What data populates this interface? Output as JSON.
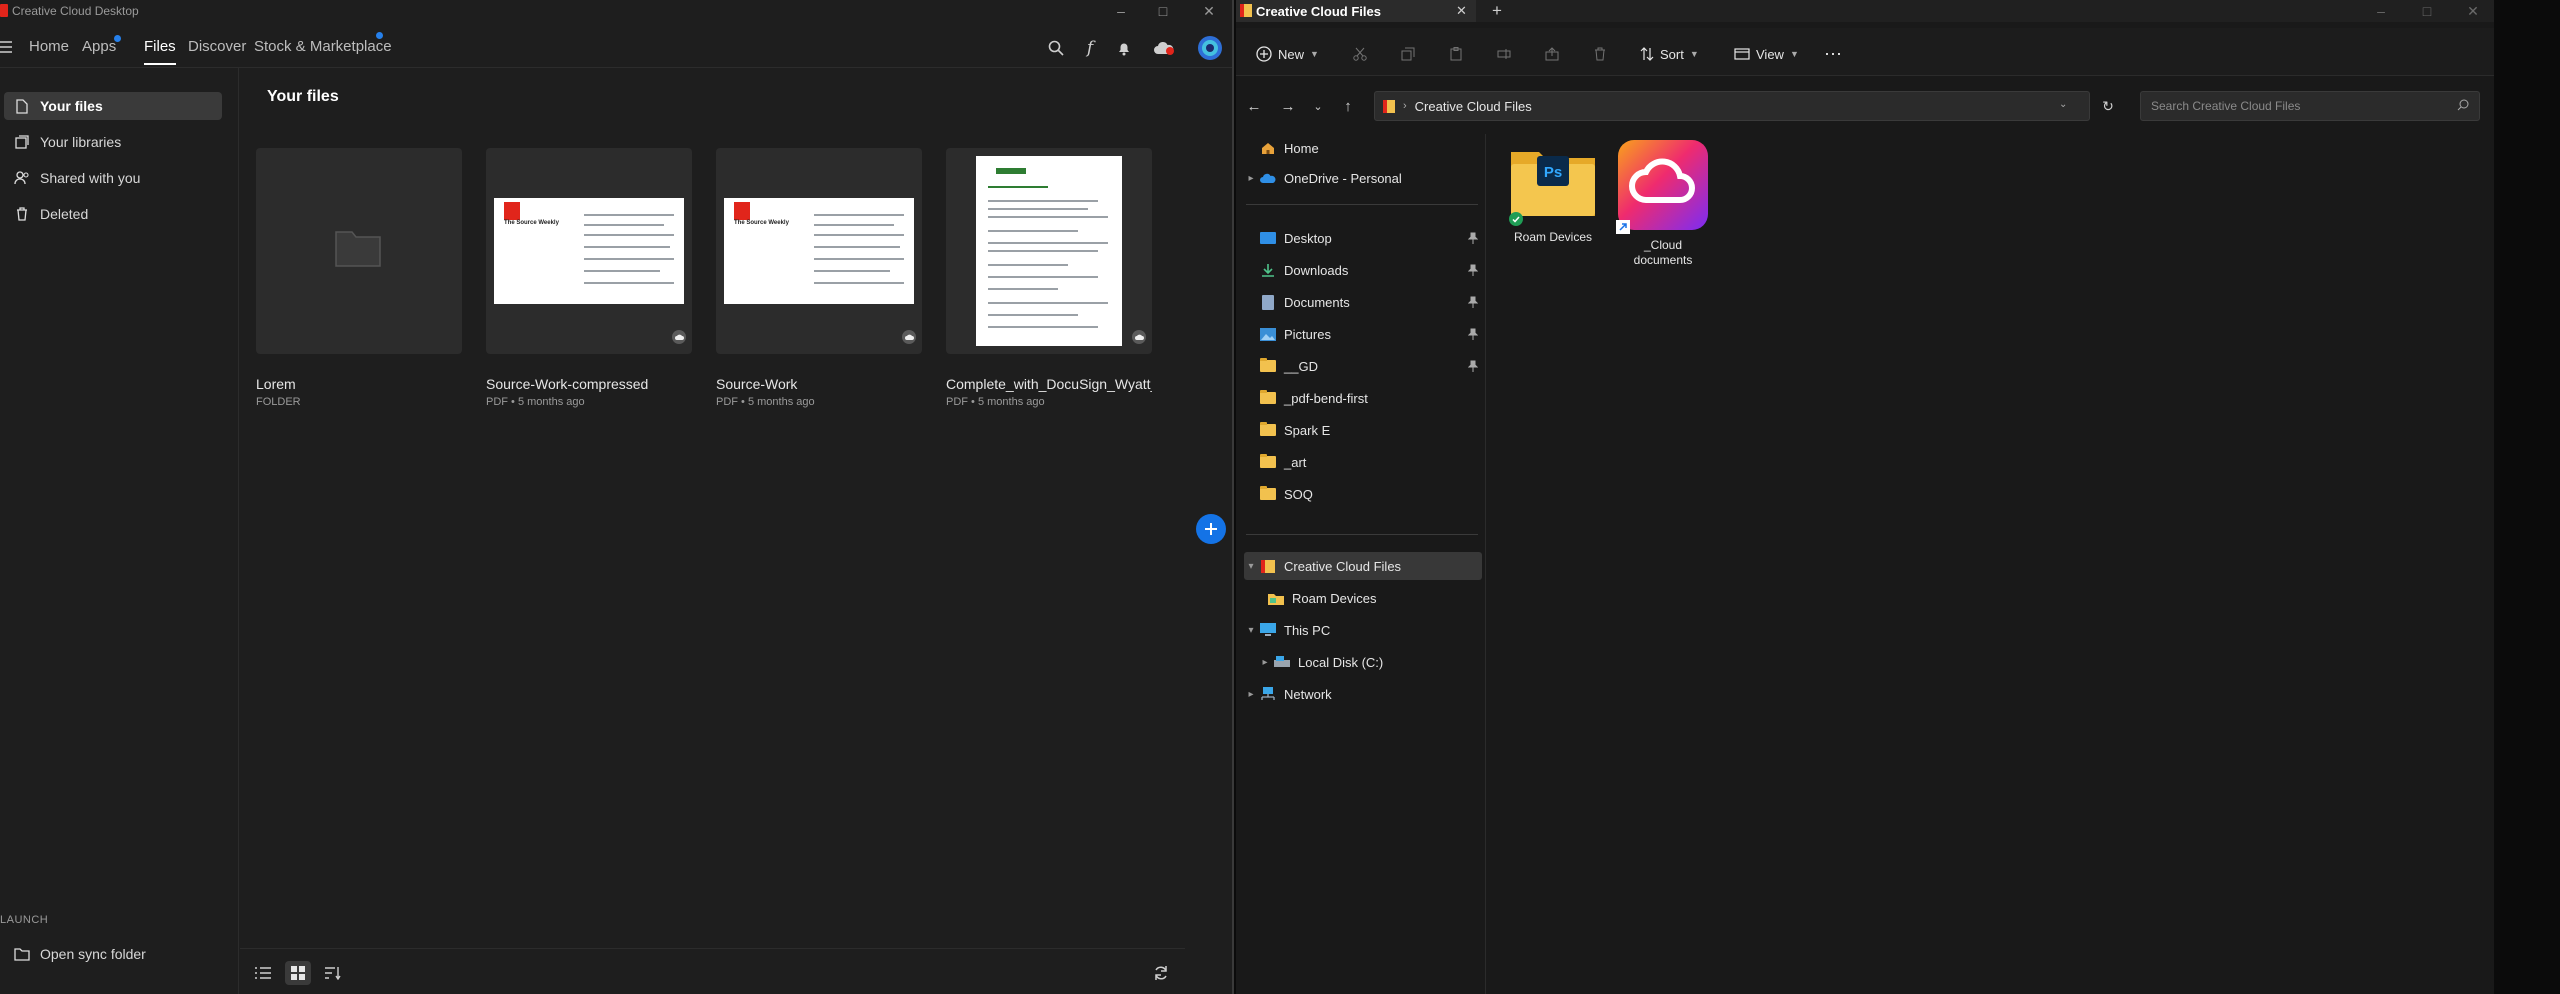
{
  "cc": {
    "window_title": "Creative Cloud Desktop",
    "nav": [
      "Home",
      "Apps",
      "Files",
      "Discover",
      "Stock & Marketplace"
    ],
    "sidebar": [
      "Your files",
      "Your libraries",
      "Shared with you",
      "Deleted"
    ],
    "launch_label": "LAUNCH",
    "open_sync_folder": "Open sync folder",
    "heading": "Your files",
    "files": [
      {
        "title": "Lorem",
        "sub": "FOLDER"
      },
      {
        "title": "Source-Work-compressed",
        "sub": "PDF • 5 months ago",
        "doc_title": "The Source Weekly"
      },
      {
        "title": "Source-Work",
        "sub": "PDF • 5 months ago",
        "doc_title": "The Source Weekly"
      },
      {
        "title": "Complete_with_DocuSign_Wyatt_m",
        "sub": "PDF • 5 months ago"
      }
    ],
    "colors": {
      "accent": "#1473e6",
      "dot": "#2680eb",
      "adobe_red": "#e1251b"
    }
  },
  "explorer": {
    "tab_title": "Creative Cloud Files",
    "toolbar": {
      "new": "New",
      "sort": "Sort",
      "view": "View"
    },
    "address": "Creative Cloud Files",
    "search_placeholder": "Search Creative Cloud Files",
    "nav": {
      "home": "Home",
      "onedrive": "OneDrive - Personal",
      "desktop": "Desktop",
      "downloads": "Downloads",
      "documents": "Documents",
      "pictures": "Pictures",
      "gd": "__GD",
      "pdf_bend": "_pdf-bend-first",
      "spark": "Spark E",
      "art": "_art",
      "soq": "SOQ",
      "ccf": "Creative Cloud Files",
      "roam": "Roam Devices",
      "thispc": "This PC",
      "localdisk": "Local Disk (C:)",
      "network": "Network"
    },
    "items": [
      {
        "label": "Roam Devices"
      },
      {
        "label": "_Cloud documents"
      }
    ]
  }
}
